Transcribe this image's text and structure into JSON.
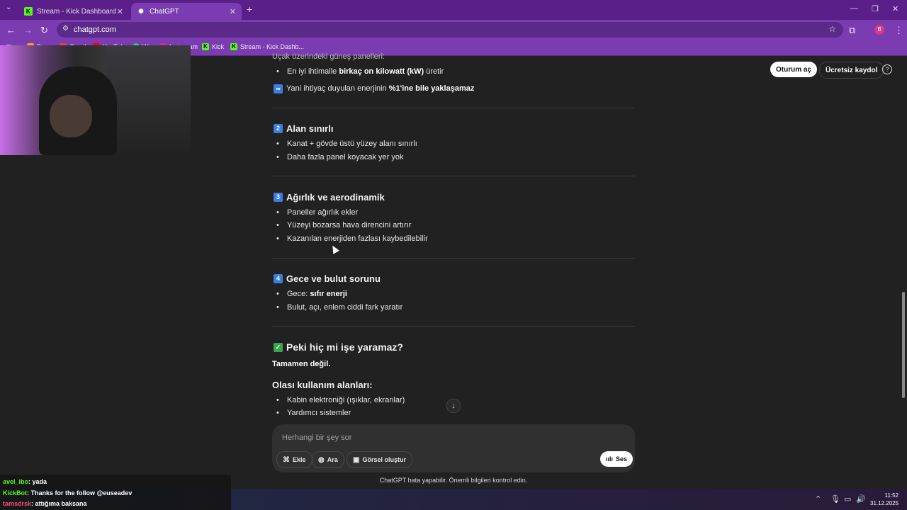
{
  "browser": {
    "tabs": [
      {
        "title": "Stream - Kick Dashboard",
        "active": false
      },
      {
        "title": "ChatGPT",
        "active": true
      }
    ],
    "url": "chatgpt.com",
    "bookmarks": [
      "Byno",
      "Gmail",
      "YouTube",
      "Wp",
      "Instagram",
      "Kick",
      "Stream - Kick Dashb..."
    ],
    "profile_initial": "B"
  },
  "header": {
    "login": "Oturum aç",
    "signup": "Ücretsiz kaydol",
    "help": "?"
  },
  "content": {
    "top_cut": "Uçak üzerindeki güneş panelleri:",
    "intro_bullet_pre": "En iyi ihtimalle ",
    "intro_bullet_bold": "birkaç on kilowatt (kW)",
    "intro_bullet_post": " üretir",
    "arrow_line_pre": "Yani ihtiyaç duyulan enerjinin ",
    "arrow_line_bold": "%1'ine bile yaklaşamaz",
    "s2_num": "2",
    "s2_title": "Alan sınırlı",
    "s2_b1": "Kanat + gövde üstü yüzey alanı sınırlı",
    "s2_b2": "Daha fazla panel koyacak yer yok",
    "s3_num": "3",
    "s3_title": "Ağırlık ve aerodinamik",
    "s3_b1": "Paneller ağırlık ekler",
    "s3_b2": "Yüzeyi bozarsa hava direncini artırır",
    "s3_b3": "Kazanılan enerjiden fazlası kaybedilebilir",
    "s4_num": "4",
    "s4_title": "Gece ve bulut sorunu",
    "s4_b1_pre": "Gece: ",
    "s4_b1_bold": "sıfır enerji",
    "s4_b2": "Bulut, açı, enlem ciddi fark yaratır",
    "s5_title": "Peki hiç mi işe yaramaz?",
    "s5_bold": "Tamamen değil.",
    "s6_title": "Olası kullanım alanları:",
    "s6_b1": "Kabin elektroniği (ışıklar, ekranlar)",
    "s6_b2": "Yardımcı sistemler"
  },
  "composer": {
    "placeholder": "Herhangi bir şey sor",
    "attach": "Ekle",
    "search": "Ara",
    "image": "Görsel oluştur",
    "voice": "Ses"
  },
  "footer": "ChatGPT hata yapabilir. Önemli bilgileri kontrol edin.",
  "stream_chat": [
    {
      "user": "avel_ibo",
      "msg": ": yada"
    },
    {
      "user": "KickBot",
      "msg": ": Thanks for the follow @euseadev"
    },
    {
      "user": "tamsdrsk",
      "msg": ": attığıma baksana"
    }
  ],
  "clock": {
    "time": "11:52",
    "date": "31.12.2025"
  },
  "colors": {
    "accent": "#7a3cb0",
    "kick": "#53fc18",
    "background": "#212121"
  }
}
